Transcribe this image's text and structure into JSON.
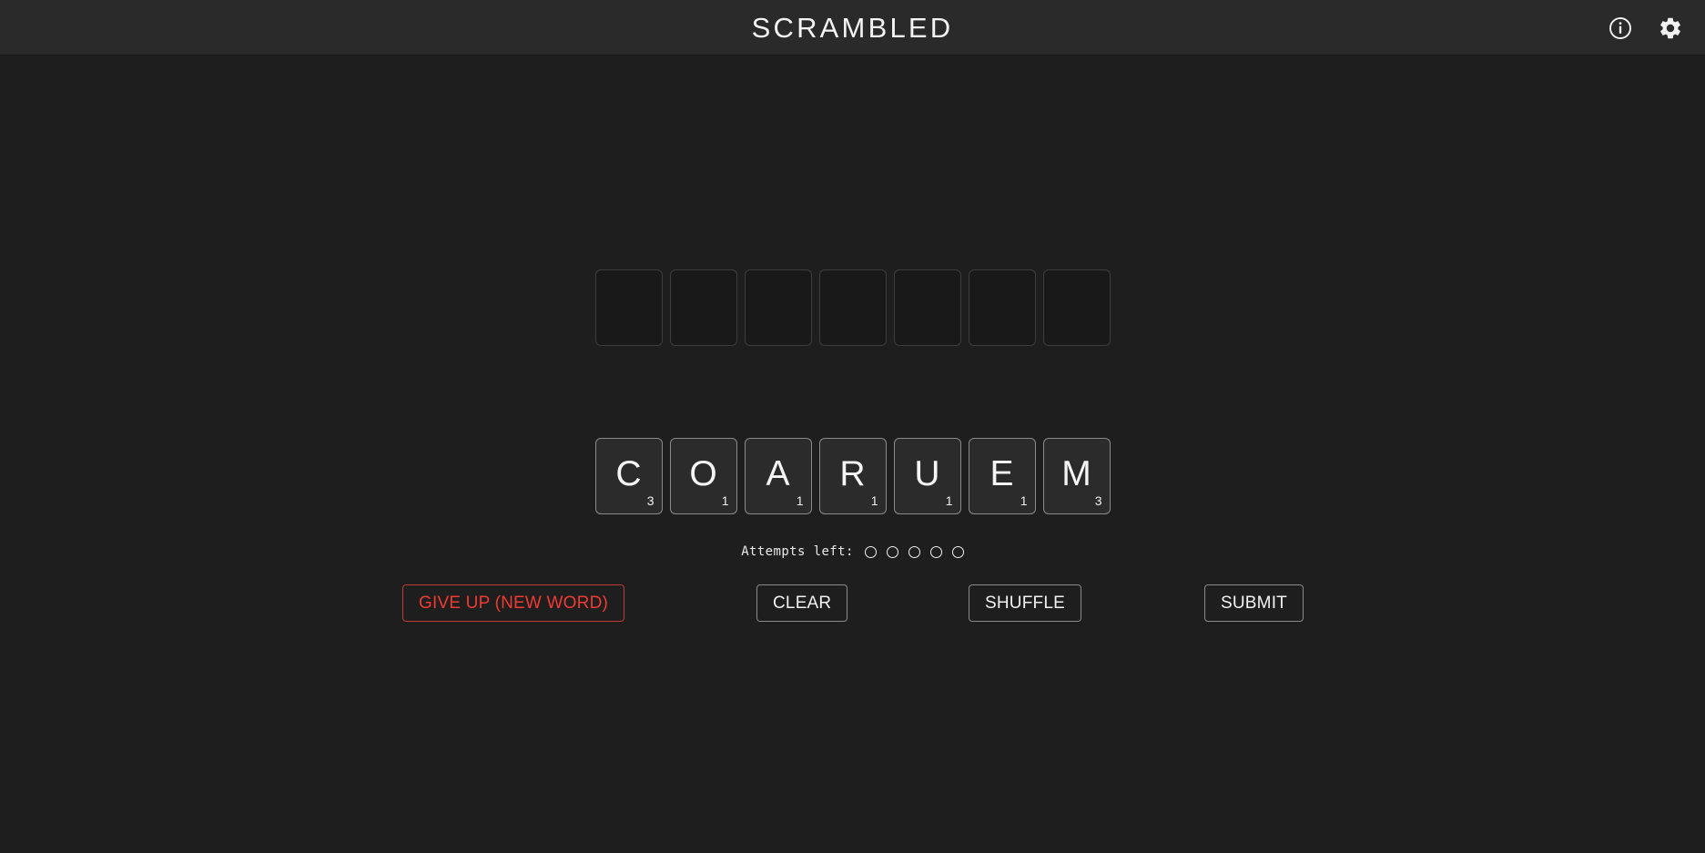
{
  "header": {
    "title": "SCRAMBLED",
    "info_icon": "info-circle-icon",
    "settings_icon": "gear-icon"
  },
  "game": {
    "answer_slots": [
      "",
      "",
      "",
      "",
      "",
      "",
      ""
    ],
    "answer_slot_count": 7,
    "rack_tiles": [
      {
        "letter": "C",
        "points": "3"
      },
      {
        "letter": "O",
        "points": "1"
      },
      {
        "letter": "A",
        "points": "1"
      },
      {
        "letter": "R",
        "points": "1"
      },
      {
        "letter": "U",
        "points": "1"
      },
      {
        "letter": "E",
        "points": "1"
      },
      {
        "letter": "M",
        "points": "3"
      }
    ],
    "attempts": {
      "label": "Attempts left:",
      "total": 5,
      "remaining": 5
    }
  },
  "controls": {
    "give_up": "GIVE UP (NEW WORD)",
    "clear": "CLEAR",
    "shuffle": "SHUFFLE",
    "submit": "SUBMIT"
  },
  "colors": {
    "background": "#1e1e1e",
    "header_background": "#2a2a2a",
    "tile_background": "#2b2b2b",
    "slot_background": "#191919",
    "text": "#f2f2f2",
    "danger": "#ef3b32",
    "border": "#8a8a8a"
  }
}
